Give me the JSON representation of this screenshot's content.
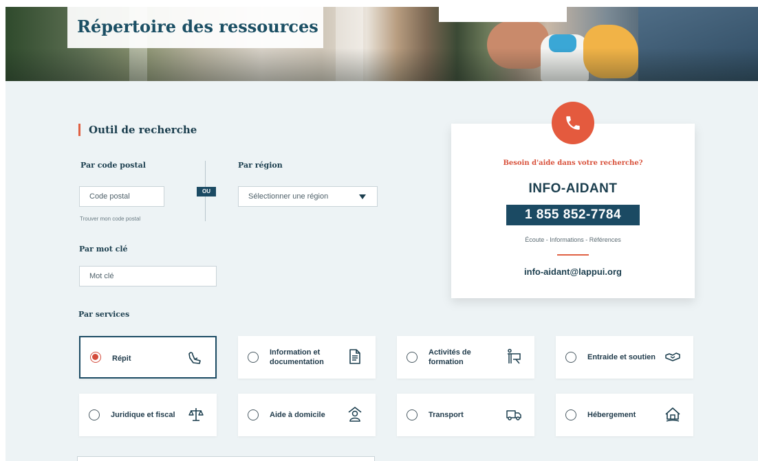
{
  "header": {
    "title": "Répertoire des ressources"
  },
  "search": {
    "section_title": "Outil de recherche",
    "postal": {
      "label": "Par code postal",
      "placeholder": "Code postal",
      "hint": "Trouver mon code postal"
    },
    "separator": "OU",
    "region": {
      "label": "Par région",
      "selected": "Sélectionner une région"
    },
    "keyword": {
      "label": "Par mot clé",
      "placeholder": "Mot clé"
    },
    "services_label": "Par services",
    "services": [
      {
        "label": "Répit",
        "icon": "hand-heart-icon",
        "selected": true
      },
      {
        "label": "Information et documentation",
        "icon": "document-icon",
        "selected": false
      },
      {
        "label": "Activités de formation",
        "icon": "presentation-board-icon",
        "selected": false
      },
      {
        "label": "Entraide et soutien",
        "icon": "handshake-icon",
        "selected": false
      },
      {
        "label": "Juridique et fiscal",
        "icon": "scales-icon",
        "selected": false
      },
      {
        "label": "Aide à domicile",
        "icon": "home-aide-icon",
        "selected": false
      },
      {
        "label": "Transport",
        "icon": "truck-icon",
        "selected": false
      },
      {
        "label": "Hébergement",
        "icon": "house-icon",
        "selected": false
      }
    ]
  },
  "help_panel": {
    "question": "Besoin d'aide dans votre recherche?",
    "brand": "INFO-AIDANT",
    "phone": "1 855 852-7784",
    "tagline": "Écoute - Informations - Références",
    "email": "info-aidant@lappui.org",
    "icon": "phone-icon"
  },
  "colors": {
    "accent": "#e45a3e",
    "primary": "#1b4a63",
    "background": "#edf3f5"
  }
}
